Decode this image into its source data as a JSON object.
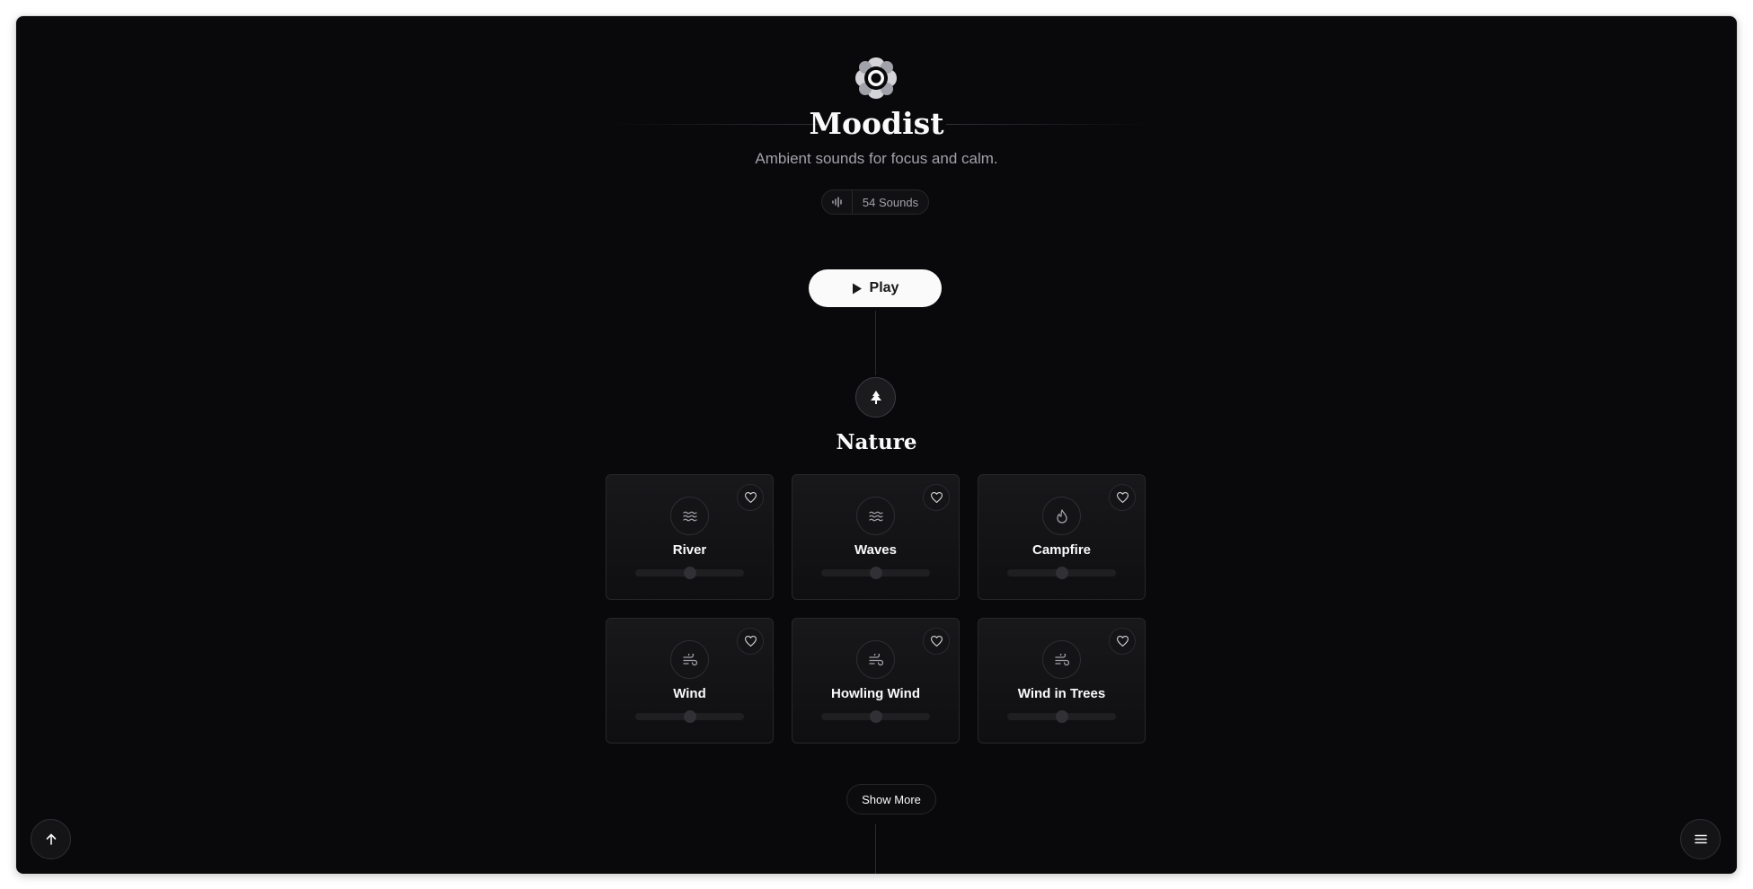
{
  "app": {
    "title": "Moodist",
    "tagline": "Ambient sounds for focus and calm.",
    "sound_count": "54 Sounds",
    "logo_icon": "moodist-flower-logo",
    "play_label": "Play"
  },
  "category": {
    "title": "Nature",
    "icon": "tree-icon"
  },
  "sounds": [
    {
      "label": "River",
      "icon": "water-icon",
      "volume": 0.5
    },
    {
      "label": "Waves",
      "icon": "waves-icon",
      "volume": 0.5
    },
    {
      "label": "Campfire",
      "icon": "flame-icon",
      "volume": 0.5
    },
    {
      "label": "Wind",
      "icon": "wind-icon",
      "volume": 0.5
    },
    {
      "label": "Howling Wind",
      "icon": "wind-icon",
      "volume": 0.5
    },
    {
      "label": "Wind in Trees",
      "icon": "wind-icon",
      "volume": 0.5
    }
  ],
  "show_more_label": "Show More",
  "controls": {
    "scroll_top_icon": "arrow-up-icon",
    "menu_icon": "menu-icon"
  },
  "colors": {
    "background": "#09090b",
    "card_border": "#27272a",
    "text": "#fafafa",
    "muted_text": "#a1a1aa",
    "play_button": "#fafafa"
  }
}
